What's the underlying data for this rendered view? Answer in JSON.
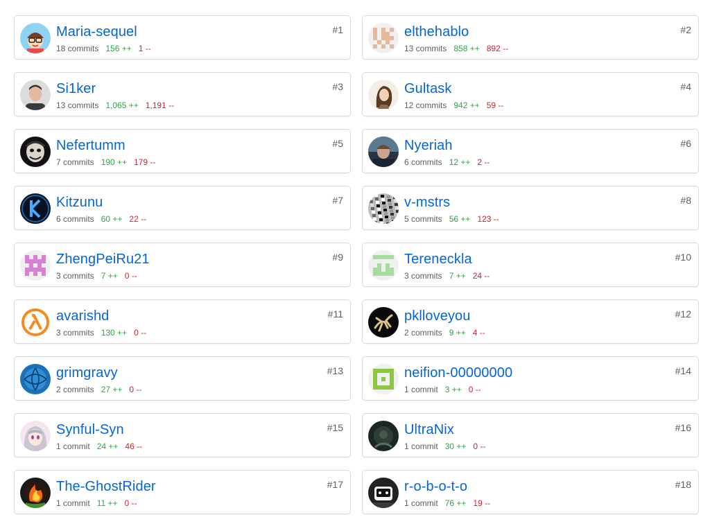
{
  "contributors": [
    {
      "rank": "#1",
      "login": "Maria-sequel",
      "commits": "18 commits",
      "additions": "156 ++",
      "deletions": "1 --",
      "avatar": {
        "kind": "cartoon",
        "bg": "#8fd3f4"
      }
    },
    {
      "rank": "#2",
      "login": "elthehablo",
      "commits": "13 commits",
      "additions": "858 ++",
      "deletions": "892 --",
      "avatar": {
        "kind": "identicon",
        "bg": "#f0f0f0",
        "fg": "#e5b99a",
        "pattern": [
          1,
          0,
          1,
          0,
          1,
          1,
          0,
          1,
          1,
          0,
          1,
          0,
          1,
          1,
          1,
          0,
          1,
          0,
          1,
          0,
          1,
          0,
          1,
          0,
          1
        ]
      }
    },
    {
      "rank": "#3",
      "login": "Si1ker",
      "commits": "13 commits",
      "additions": "1,065 ++",
      "deletions": "1,191 --",
      "avatar": {
        "kind": "photo-face",
        "bg": "#dcdcdc",
        "skin": "#e3b9a0",
        "hair": "#2c2c2c",
        "shirt": "#3a3a3a"
      }
    },
    {
      "rank": "#4",
      "login": "Gultask",
      "commits": "12 commits",
      "additions": "942 ++",
      "deletions": "59 --",
      "avatar": {
        "kind": "sketch",
        "bg": "#f3efe6"
      }
    },
    {
      "rank": "#5",
      "login": "Nefertumm",
      "commits": "7 commits",
      "additions": "190 ++",
      "deletions": "179 --",
      "avatar": {
        "kind": "joker",
        "bg": "#111111"
      }
    },
    {
      "rank": "#6",
      "login": "Nyeriah",
      "commits": "6 commits",
      "additions": "12 ++",
      "deletions": "2 --",
      "avatar": {
        "kind": "photo-dark",
        "bg": "#2a3440"
      }
    },
    {
      "rank": "#7",
      "login": "Kitzunu",
      "commits": "6 commits",
      "additions": "60 ++",
      "deletions": "22 --",
      "avatar": {
        "kind": "k-logo",
        "bg": "#08121f"
      }
    },
    {
      "rank": "#8",
      "login": "v-mstrs",
      "commits": "5 commits",
      "additions": "56 ++",
      "deletions": "123 --",
      "avatar": {
        "kind": "noise",
        "bg": "#bdbdbd"
      }
    },
    {
      "rank": "#9",
      "login": "ZhengPeiRu21",
      "commits": "3 commits",
      "additions": "7 ++",
      "deletions": "0 --",
      "avatar": {
        "kind": "identicon",
        "bg": "#f0f0f0",
        "fg": "#d87fd6",
        "pattern": [
          1,
          0,
          1,
          0,
          1,
          1,
          1,
          1,
          1,
          1,
          0,
          1,
          0,
          1,
          0,
          1,
          1,
          1,
          1,
          1,
          1,
          0,
          1,
          0,
          1
        ]
      }
    },
    {
      "rank": "#10",
      "login": "Tereneckla",
      "commits": "3 commits",
      "additions": "7 ++",
      "deletions": "24 --",
      "avatar": {
        "kind": "identicon",
        "bg": "#f0f0f0",
        "fg": "#a6dd9e",
        "pattern": [
          1,
          1,
          1,
          1,
          1,
          0,
          0,
          0,
          0,
          0,
          0,
          1,
          0,
          1,
          0,
          1,
          1,
          0,
          1,
          1,
          1,
          1,
          1,
          1,
          1
        ]
      }
    },
    {
      "rank": "#11",
      "login": "avarishd",
      "commits": "3 commits",
      "additions": "130 ++",
      "deletions": "0 --",
      "avatar": {
        "kind": "lambda",
        "bg": "#ffffff",
        "fg": "#f58a1f"
      }
    },
    {
      "rank": "#12",
      "login": "pklloveyou",
      "commits": "2 commits",
      "additions": "9 ++",
      "deletions": "4 --",
      "avatar": {
        "kind": "gecko",
        "bg": "#0a0a0a"
      }
    },
    {
      "rank": "#13",
      "login": "grimgravy",
      "commits": "2 commits",
      "additions": "27 ++",
      "deletions": "0 --",
      "avatar": {
        "kind": "globe",
        "bg": "#1b70b8"
      }
    },
    {
      "rank": "#14",
      "login": "neifion-00000000",
      "commits": "1 commit",
      "additions": "3 ++",
      "deletions": "0 --",
      "avatar": {
        "kind": "identicon",
        "bg": "#f0f0f0",
        "fg": "#8dc63f",
        "pattern": [
          1,
          1,
          1,
          1,
          1,
          1,
          0,
          0,
          0,
          1,
          1,
          0,
          1,
          0,
          1,
          1,
          0,
          0,
          0,
          1,
          1,
          1,
          1,
          1,
          1
        ]
      }
    },
    {
      "rank": "#15",
      "login": "Synful-Syn",
      "commits": "1 commit",
      "additions": "24 ++",
      "deletions": "46 --",
      "avatar": {
        "kind": "anime",
        "bg": "#f4e6ee"
      }
    },
    {
      "rank": "#16",
      "login": "UltraNix",
      "commits": "1 commit",
      "additions": "30 ++",
      "deletions": "0 --",
      "avatar": {
        "kind": "dark-art",
        "bg": "#1c2622"
      }
    },
    {
      "rank": "#17",
      "login": "The-GhostRider",
      "commits": "1 commit",
      "additions": "11 ++",
      "deletions": "0 --",
      "avatar": {
        "kind": "fire",
        "bg": "#1a1a1a"
      }
    },
    {
      "rank": "#18",
      "login": "r-o-b-o-t-o",
      "commits": "1 commit",
      "additions": "76 ++",
      "deletions": "19 --",
      "avatar": {
        "kind": "robot",
        "bg": "#222222"
      }
    }
  ]
}
